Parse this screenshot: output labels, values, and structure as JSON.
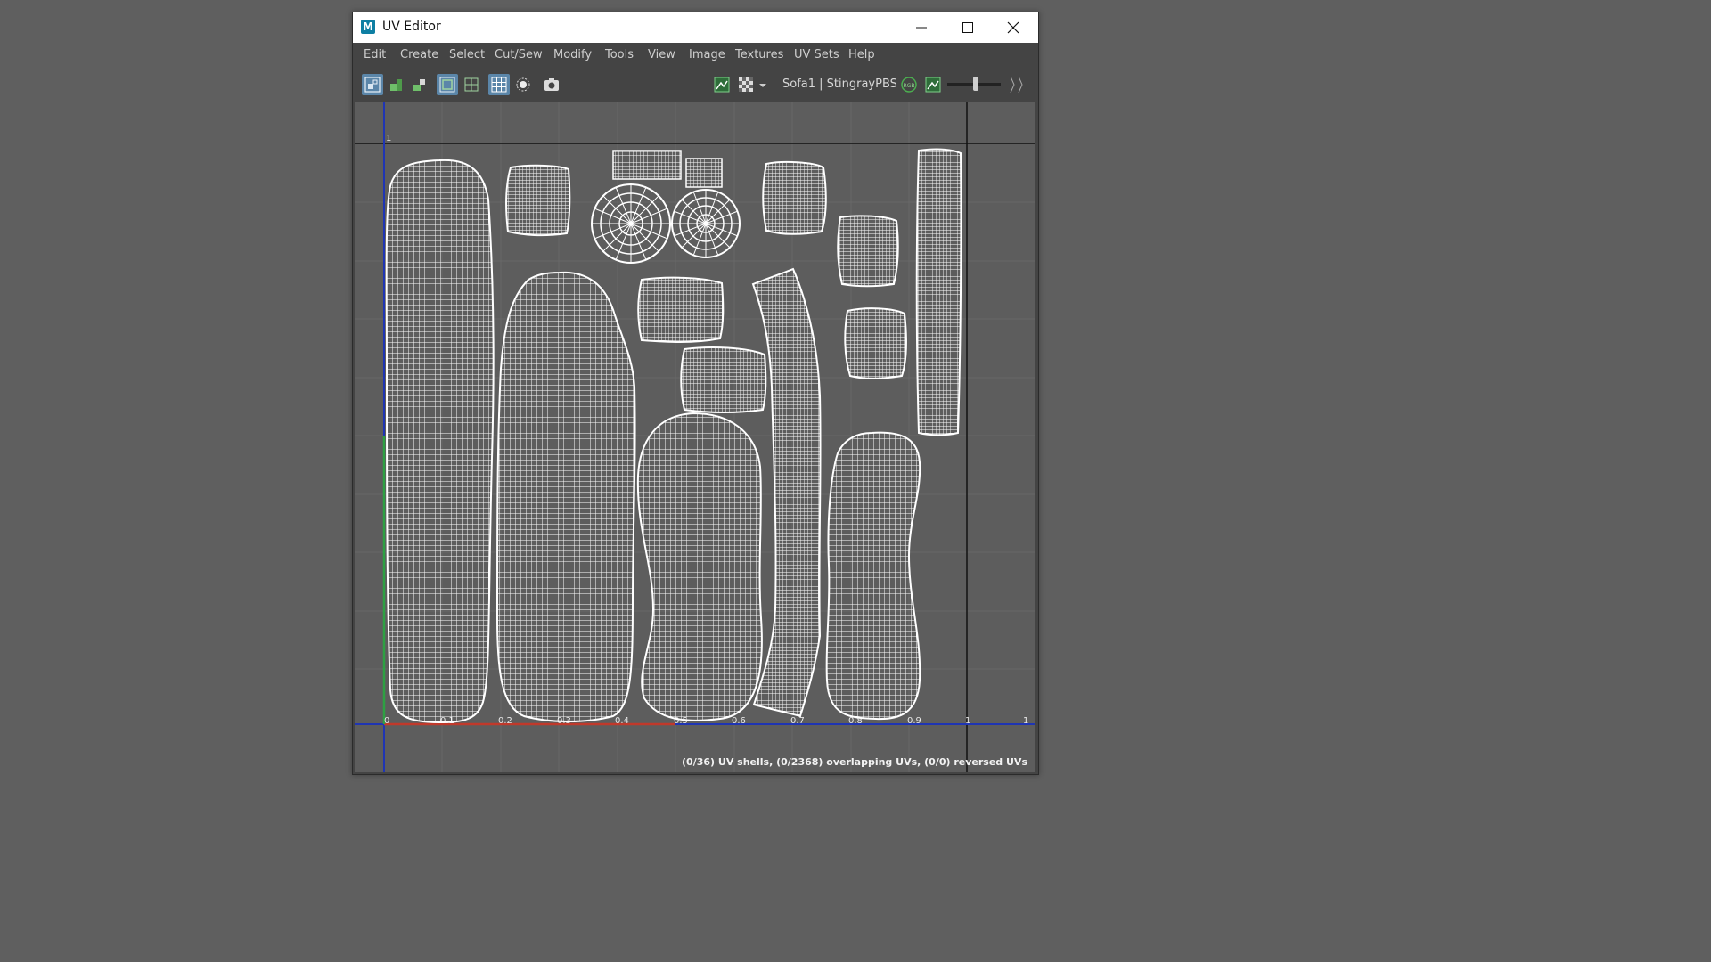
{
  "window": {
    "title": "UV Editor",
    "app_icon": "M",
    "controls": [
      "minimize-icon",
      "maximize-icon",
      "close-icon"
    ]
  },
  "menu": [
    "Edit",
    "Create",
    "Select",
    "Cut/Sew",
    "Modify",
    "Tools",
    "View",
    "Image",
    "Textures",
    "UV Sets",
    "Help"
  ],
  "toolbar": {
    "uv_set": "Sofa1 | StingrayPBS1S",
    "rgb_icon_label": "RGB",
    "icons": [
      "uv-shell-icon",
      "stack-shells-icon",
      "orient-shells-icon",
      "wireframe-icon",
      "shaded-icon",
      "grid-icon",
      "pixel-snap-icon",
      "snapshot-icon",
      "image-display-icon",
      "checker-icon",
      "dropdown-icon",
      "rgb-icon",
      "exposure-icon",
      "slider-icon"
    ]
  },
  "viewport": {
    "u_ticks": [
      "0",
      "0.1",
      "0.2",
      "0.3",
      "0.4",
      "0.5",
      "0.6",
      "0.7",
      "0.8",
      "0.9",
      "1",
      "1"
    ],
    "v_top_tick": "1",
    "status": "(0/36) UV shells, (0/2368) overlapping UVs, (0/0) reversed UVs"
  },
  "colors": {
    "background": "#5f5f5f",
    "panel": "#444444",
    "viewport": "#5d5d5d",
    "uv_lines": "#ffffff",
    "u_axis": "#c0392b",
    "v_axis": "#2ea043",
    "border_axis": "#1f35b4"
  }
}
